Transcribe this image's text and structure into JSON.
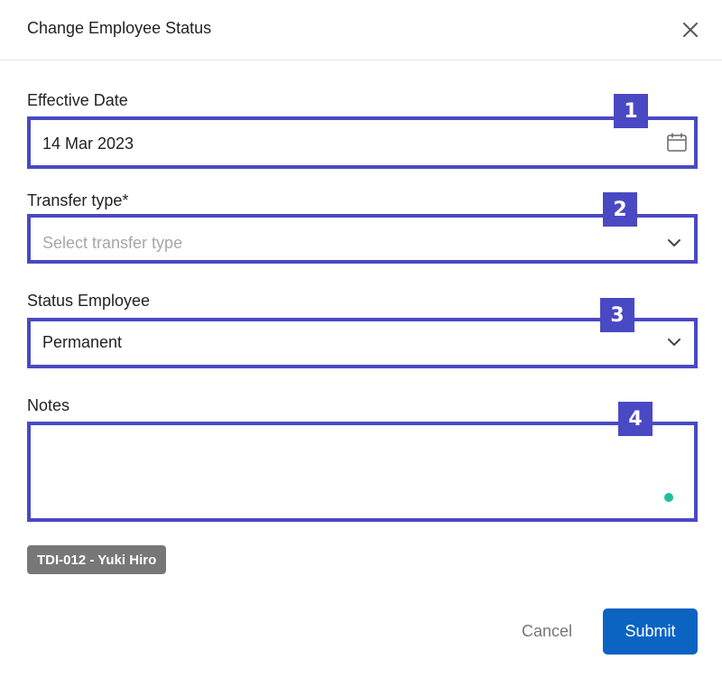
{
  "dialog": {
    "title": "Change Employee Status"
  },
  "form": {
    "effective_date": {
      "label": "Effective Date",
      "value": "14 Mar 2023",
      "badge": "1"
    },
    "transfer_type": {
      "label": "Transfer type*",
      "placeholder": "Select transfer type",
      "badge": "2"
    },
    "status_employee": {
      "label": "Status Employee",
      "value": "Permanent",
      "badge": "3"
    },
    "notes": {
      "label": "Notes",
      "value": "",
      "badge": "4"
    }
  },
  "tag": {
    "label": "TDI-012 - Yuki Hiro"
  },
  "footer": {
    "cancel_label": "Cancel",
    "submit_label": "Submit"
  },
  "colors": {
    "highlight_border": "#4a49c4",
    "submit": "#0b63c2",
    "tag_bg": "#777777",
    "notes_dot": "#1dbf9b"
  }
}
